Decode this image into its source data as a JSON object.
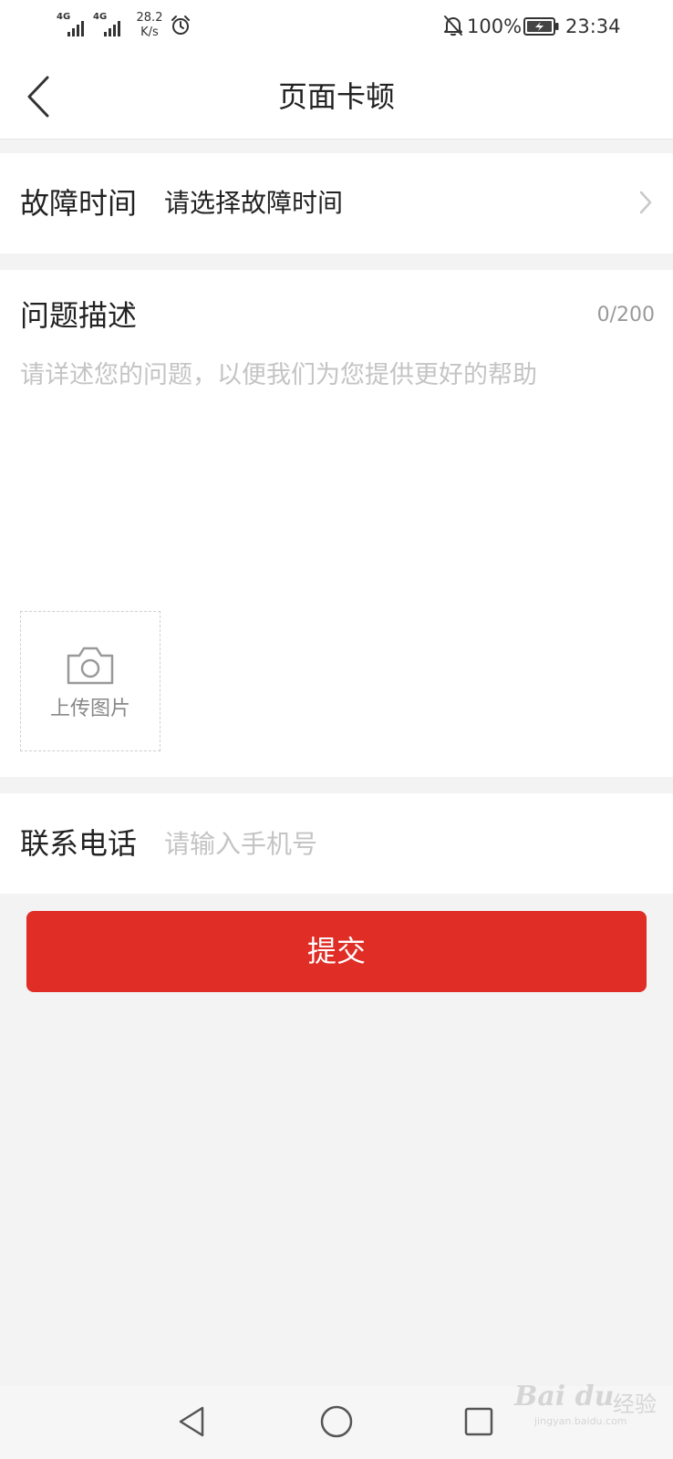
{
  "status_bar": {
    "network_1": "4G",
    "network_2": "4G",
    "speed_value": "28.2",
    "speed_unit": "K/s",
    "battery": "100%",
    "time": "23:34"
  },
  "header": {
    "title": "页面卡顿"
  },
  "fault_time": {
    "label": "故障时间",
    "value": "请选择故障时间"
  },
  "description": {
    "label": "问题描述",
    "counter": "0/200",
    "placeholder": "请详述您的问题，以便我们为您提供更好的帮助",
    "upload_label": "上传图片"
  },
  "contact": {
    "label": "联系电话",
    "placeholder": "请输入手机号"
  },
  "submit": {
    "label": "提交"
  },
  "watermark": {
    "brand": "Bai du",
    "service": "经验",
    "url": "jingyan.baidu.com"
  },
  "colors": {
    "accent": "#e02d25",
    "page_background": "#f3f3f4"
  }
}
